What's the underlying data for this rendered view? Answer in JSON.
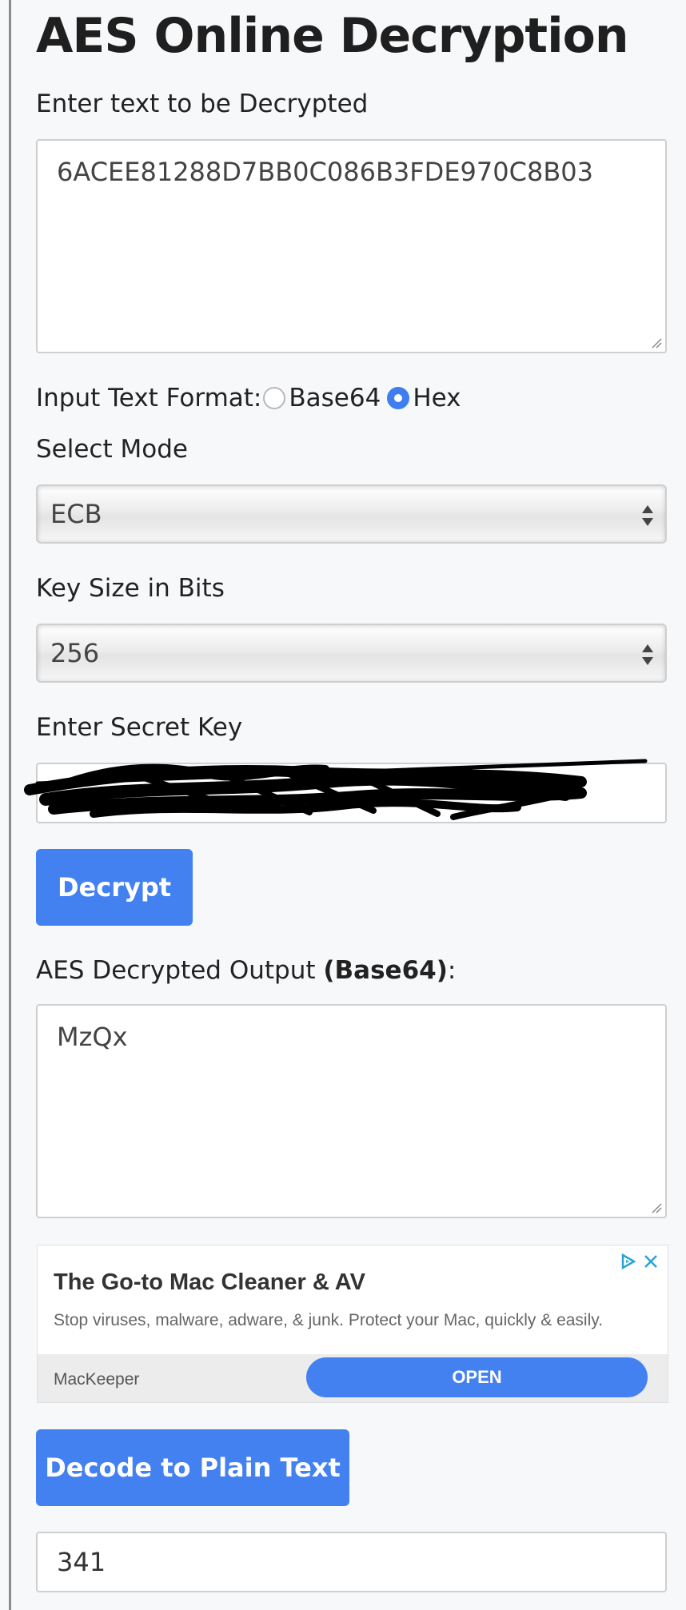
{
  "title": "AES Online Decryption",
  "input_section": {
    "label": "Enter text to be Decrypted",
    "value": "6ACEE81288D7BB0C086B3FDE970C8B03"
  },
  "format": {
    "label": "Input Text Format:",
    "options": [
      "Base64",
      "Hex"
    ],
    "selected": "Hex"
  },
  "mode": {
    "label": "Select Mode",
    "value": "ECB"
  },
  "key_size": {
    "label": "Key Size in Bits",
    "value": "256"
  },
  "secret_key": {
    "label": "Enter Secret Key",
    "value": "",
    "redacted": true
  },
  "decrypt_button": "Decrypt",
  "output": {
    "label_prefix": "AES Decrypted Output ",
    "label_bold": "(Base64)",
    "label_suffix": ":",
    "value": "MzQx"
  },
  "ad": {
    "headline": "The Go-to Mac Cleaner & AV",
    "body": "Stop viruses, malware, adware, & junk. Protect your Mac, quickly & easily.",
    "advertiser": "MacKeeper",
    "cta": "OPEN",
    "accent": "#4481f0",
    "icons": [
      "adchoices-icon",
      "close-icon"
    ]
  },
  "decode_button": "Decode to Plain Text",
  "plain_text_output": "341",
  "colors": {
    "accent": "#4481f0",
    "border": "#cfcfcf",
    "background": "#f7f8fa"
  }
}
